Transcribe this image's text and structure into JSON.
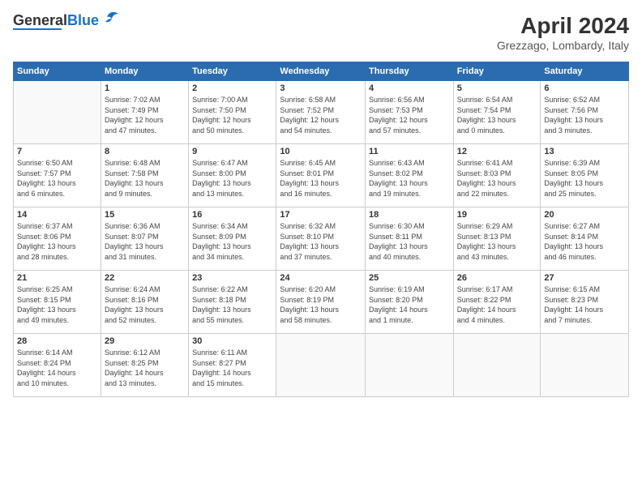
{
  "header": {
    "logo_general": "General",
    "logo_blue": "Blue",
    "month_year": "April 2024",
    "location": "Grezzago, Lombardy, Italy"
  },
  "days_of_week": [
    "Sunday",
    "Monday",
    "Tuesday",
    "Wednesday",
    "Thursday",
    "Friday",
    "Saturday"
  ],
  "weeks": [
    [
      {
        "day": "",
        "info": ""
      },
      {
        "day": "1",
        "info": "Sunrise: 7:02 AM\nSunset: 7:49 PM\nDaylight: 12 hours\nand 47 minutes."
      },
      {
        "day": "2",
        "info": "Sunrise: 7:00 AM\nSunset: 7:50 PM\nDaylight: 12 hours\nand 50 minutes."
      },
      {
        "day": "3",
        "info": "Sunrise: 6:58 AM\nSunset: 7:52 PM\nDaylight: 12 hours\nand 54 minutes."
      },
      {
        "day": "4",
        "info": "Sunrise: 6:56 AM\nSunset: 7:53 PM\nDaylight: 12 hours\nand 57 minutes."
      },
      {
        "day": "5",
        "info": "Sunrise: 6:54 AM\nSunset: 7:54 PM\nDaylight: 13 hours\nand 0 minutes."
      },
      {
        "day": "6",
        "info": "Sunrise: 6:52 AM\nSunset: 7:56 PM\nDaylight: 13 hours\nand 3 minutes."
      }
    ],
    [
      {
        "day": "7",
        "info": "Sunrise: 6:50 AM\nSunset: 7:57 PM\nDaylight: 13 hours\nand 6 minutes."
      },
      {
        "day": "8",
        "info": "Sunrise: 6:48 AM\nSunset: 7:58 PM\nDaylight: 13 hours\nand 9 minutes."
      },
      {
        "day": "9",
        "info": "Sunrise: 6:47 AM\nSunset: 8:00 PM\nDaylight: 13 hours\nand 13 minutes."
      },
      {
        "day": "10",
        "info": "Sunrise: 6:45 AM\nSunset: 8:01 PM\nDaylight: 13 hours\nand 16 minutes."
      },
      {
        "day": "11",
        "info": "Sunrise: 6:43 AM\nSunset: 8:02 PM\nDaylight: 13 hours\nand 19 minutes."
      },
      {
        "day": "12",
        "info": "Sunrise: 6:41 AM\nSunset: 8:03 PM\nDaylight: 13 hours\nand 22 minutes."
      },
      {
        "day": "13",
        "info": "Sunrise: 6:39 AM\nSunset: 8:05 PM\nDaylight: 13 hours\nand 25 minutes."
      }
    ],
    [
      {
        "day": "14",
        "info": "Sunrise: 6:37 AM\nSunset: 8:06 PM\nDaylight: 13 hours\nand 28 minutes."
      },
      {
        "day": "15",
        "info": "Sunrise: 6:36 AM\nSunset: 8:07 PM\nDaylight: 13 hours\nand 31 minutes."
      },
      {
        "day": "16",
        "info": "Sunrise: 6:34 AM\nSunset: 8:09 PM\nDaylight: 13 hours\nand 34 minutes."
      },
      {
        "day": "17",
        "info": "Sunrise: 6:32 AM\nSunset: 8:10 PM\nDaylight: 13 hours\nand 37 minutes."
      },
      {
        "day": "18",
        "info": "Sunrise: 6:30 AM\nSunset: 8:11 PM\nDaylight: 13 hours\nand 40 minutes."
      },
      {
        "day": "19",
        "info": "Sunrise: 6:29 AM\nSunset: 8:13 PM\nDaylight: 13 hours\nand 43 minutes."
      },
      {
        "day": "20",
        "info": "Sunrise: 6:27 AM\nSunset: 8:14 PM\nDaylight: 13 hours\nand 46 minutes."
      }
    ],
    [
      {
        "day": "21",
        "info": "Sunrise: 6:25 AM\nSunset: 8:15 PM\nDaylight: 13 hours\nand 49 minutes."
      },
      {
        "day": "22",
        "info": "Sunrise: 6:24 AM\nSunset: 8:16 PM\nDaylight: 13 hours\nand 52 minutes."
      },
      {
        "day": "23",
        "info": "Sunrise: 6:22 AM\nSunset: 8:18 PM\nDaylight: 13 hours\nand 55 minutes."
      },
      {
        "day": "24",
        "info": "Sunrise: 6:20 AM\nSunset: 8:19 PM\nDaylight: 13 hours\nand 58 minutes."
      },
      {
        "day": "25",
        "info": "Sunrise: 6:19 AM\nSunset: 8:20 PM\nDaylight: 14 hours\nand 1 minute."
      },
      {
        "day": "26",
        "info": "Sunrise: 6:17 AM\nSunset: 8:22 PM\nDaylight: 14 hours\nand 4 minutes."
      },
      {
        "day": "27",
        "info": "Sunrise: 6:15 AM\nSunset: 8:23 PM\nDaylight: 14 hours\nand 7 minutes."
      }
    ],
    [
      {
        "day": "28",
        "info": "Sunrise: 6:14 AM\nSunset: 8:24 PM\nDaylight: 14 hours\nand 10 minutes."
      },
      {
        "day": "29",
        "info": "Sunrise: 6:12 AM\nSunset: 8:25 PM\nDaylight: 14 hours\nand 13 minutes."
      },
      {
        "day": "30",
        "info": "Sunrise: 6:11 AM\nSunset: 8:27 PM\nDaylight: 14 hours\nand 15 minutes."
      },
      {
        "day": "",
        "info": ""
      },
      {
        "day": "",
        "info": ""
      },
      {
        "day": "",
        "info": ""
      },
      {
        "day": "",
        "info": ""
      }
    ]
  ]
}
